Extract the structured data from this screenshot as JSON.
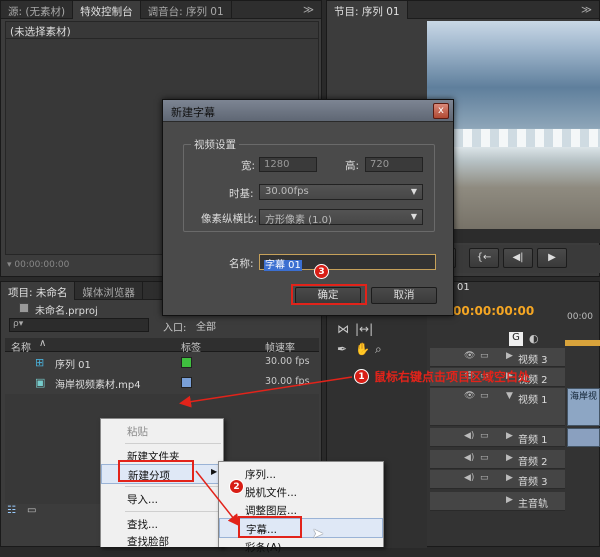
{
  "colors": {
    "accent_red": "#e2231a",
    "timecode_orange": "#f5a623",
    "label_green": "#3fbf3f",
    "label_blue": "#7aa0d8"
  },
  "source_panel": {
    "tabs": [
      "源: (无素材)",
      "特效控制台",
      "调音台: 序列 01"
    ],
    "menu_glyph": "≫",
    "empty_label": "(未选择素材)",
    "timecode": "00:00:00:00"
  },
  "program_panel": {
    "tab": "节目: 序列 01",
    "menu_glyph": "≫"
  },
  "project_panel": {
    "tabs": [
      "项目: 未命名",
      "媒体浏览器"
    ],
    "project_file": "未命名.prproj",
    "search_placeholder": "ρ▾",
    "entry_label": "入口:",
    "entry_value": "全部",
    "columns": {
      "name": "名称",
      "label": "标签",
      "framerate": "帧速率"
    },
    "items": [
      {
        "name": "序列 01",
        "fps": "30.00 fps",
        "label_color": "#3fbf3f"
      },
      {
        "name": "海岸视频素材.mp4",
        "fps": "30.00 fps",
        "label_color": "#7aa0d8"
      }
    ]
  },
  "timeline": {
    "tab": "01",
    "timecode": "00:00:00:00",
    "ruler_label": "00:00",
    "tracks": [
      {
        "name": "视频 3",
        "type": "video"
      },
      {
        "name": "视频 2",
        "type": "video"
      },
      {
        "name": "视频 1",
        "type": "video",
        "clip": "海岸视"
      },
      {
        "name": "音频 1",
        "type": "audio"
      },
      {
        "name": "音频 2",
        "type": "audio"
      },
      {
        "name": "音频 3",
        "type": "audio"
      },
      {
        "name": "主音轨",
        "type": "master"
      }
    ]
  },
  "dialog": {
    "title": "新建字幕",
    "close": "x",
    "group_label": "视频设置",
    "width_label": "宽:",
    "width_value": "1280",
    "height_label": "高:",
    "height_value": "720",
    "timebase_label": "时基:",
    "timebase_value": "30.00fps",
    "pixel_aspect_label": "像素纵横比:",
    "pixel_aspect_value": "方形像素 (1.0)",
    "name_label": "名称:",
    "name_value": "字幕 01",
    "ok": "确定",
    "cancel": "取消"
  },
  "context_menu": {
    "items": [
      "粘贴",
      "新建文件夹",
      "新建分项",
      "导入...",
      "查找...",
      "查找脸部"
    ]
  },
  "submenu": {
    "items": [
      "序列...",
      "脱机文件...",
      "调整图层...",
      "字幕...",
      "彩条(A)"
    ]
  },
  "annotations": {
    "step1": "1",
    "step1_text": "鼠标右键点击项目区域空白处",
    "step2": "2",
    "step3": "3"
  }
}
